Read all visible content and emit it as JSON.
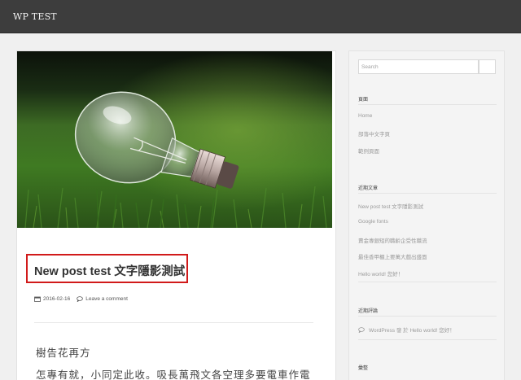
{
  "site": {
    "title": "WP TEST"
  },
  "post": {
    "title": "New post test 文字隱影測試",
    "date": "2016-02-16",
    "comment_link": "Leave a comment",
    "heading": "樹告花再方",
    "first_line": "怎專有就，小同定此收。吸長萬飛文各空理多要電車作電"
  },
  "sidebar": {
    "search_placeholder": "Search",
    "pages_title": "頁面",
    "pages": [
      "Home",
      "部落中文字頁",
      "範例頁面"
    ],
    "recent_title": "近期文章",
    "recent_posts": [
      "New post test 文字隱影測試",
      "Google fonts",
      "賣金專銀短的職齡企受性職流",
      "最佳香甲櫃上要萬大戲出盛面",
      "Hello world! 您好！"
    ],
    "comments_title": "近期評論",
    "comment_entry": "WordPress 發 於 Hello world! 您好！",
    "archive_title": "彙整"
  },
  "colors": {
    "topbar": "#3d3d3d",
    "highlight": "#d11a1a",
    "link": "#9a9a9a"
  }
}
